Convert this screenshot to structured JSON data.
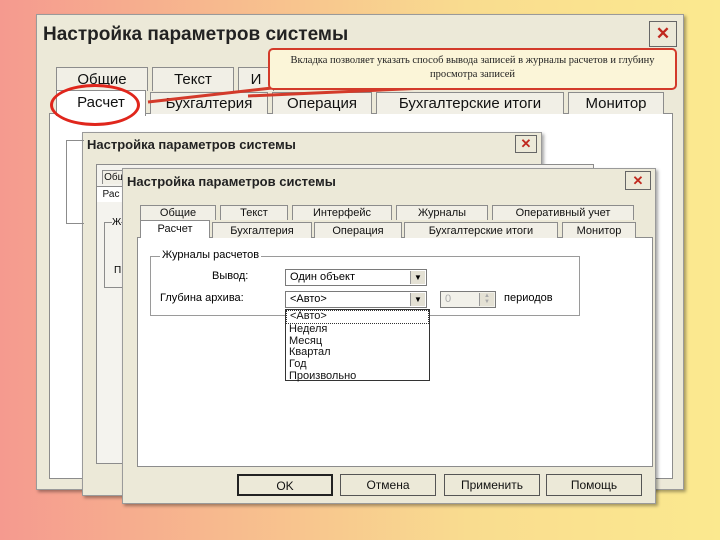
{
  "dialog_title": "Настройка параметров системы",
  "close_glyph": "✕",
  "callout_text": "Вкладка позволяет указать способ вывода записей в журналы расчетов и глубину просмотра записей",
  "back_tabs": {
    "row1": [
      "Общие",
      "Текст",
      "И"
    ],
    "row2": [
      "Расчет",
      "Бухгалтерия",
      "Операция",
      "Бухгалтерские итоги",
      "Монитор"
    ]
  },
  "mid_tabs": {
    "row1": [
      "Общ"
    ],
    "row2": [
      "Рас"
    ],
    "group_fragment": "Ж",
    "label_fragment": "П"
  },
  "front_tabs": {
    "row1": [
      "Общие",
      "Текст",
      "Интерфейс",
      "Журналы",
      "Оперативный учет"
    ],
    "row2": [
      "Расчет",
      "Бухгалтерия",
      "Операция",
      "Бухгалтерские итоги",
      "Монитор"
    ]
  },
  "group": {
    "title": "Журналы расчетов",
    "output_label": "Вывод:",
    "output_value": "Один объект",
    "depth_label": "Глубина архива:",
    "depth_value": "<Авто>",
    "spin_value": "0",
    "periods_label": "периодов"
  },
  "dropdown_options": [
    "<Авто>",
    "Неделя",
    "Месяц",
    "Квартал",
    "Год",
    "Произвольно"
  ],
  "buttons": {
    "ok": "OK",
    "cancel": "Отмена",
    "apply": "Применить",
    "help": "Помощь"
  },
  "colors": {
    "callout_border": "#d33a2a",
    "highlight_ellipse": "#e0261c"
  }
}
